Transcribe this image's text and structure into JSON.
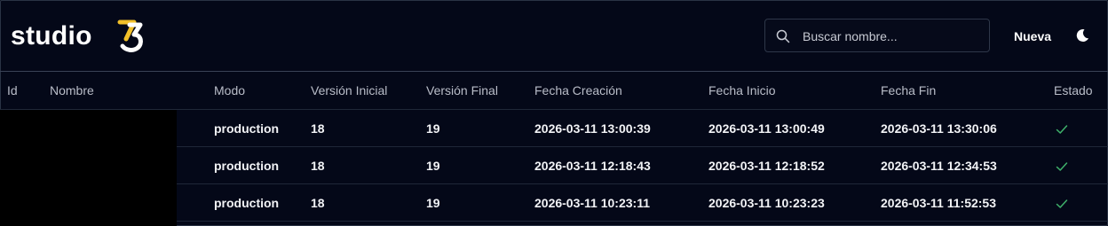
{
  "brand": {
    "word": "studio",
    "mark": "73",
    "mark_color": "#f2c029"
  },
  "search": {
    "placeholder": "Buscar nombre...",
    "value": ""
  },
  "actions": {
    "new_label": "Nueva"
  },
  "table": {
    "headers": [
      "Id",
      "Nombre",
      "Modo",
      "Versión Inicial",
      "Versión Final",
      "Fecha Creación",
      "Fecha Inicio",
      "Fecha Fin",
      "Estado"
    ],
    "rows": [
      {
        "id": "",
        "nombre": "",
        "modo": "production",
        "version_inicial": "18",
        "version_final": "19",
        "fecha_creacion": "2026-03-11 13:00:39",
        "fecha_inicio": "2026-03-11 13:00:49",
        "fecha_fin": "2026-03-11 13:30:06",
        "estado": "check-icon"
      },
      {
        "id": "",
        "nombre": "",
        "modo": "production",
        "version_inicial": "18",
        "version_final": "19",
        "fecha_creacion": "2026-03-11 12:18:43",
        "fecha_inicio": "2026-03-11 12:18:52",
        "fecha_fin": "2026-03-11 12:34:53",
        "estado": "check-icon"
      },
      {
        "id": "",
        "nombre": "",
        "modo": "production",
        "version_inicial": "18",
        "version_final": "19",
        "fecha_creacion": "2026-03-11 10:23:11",
        "fecha_inicio": "2026-03-11 10:23:23",
        "fecha_fin": "2026-03-11 11:52:53",
        "estado": "check-icon"
      }
    ]
  },
  "colors": {
    "background": "#040818",
    "success": "#3fb26b"
  }
}
